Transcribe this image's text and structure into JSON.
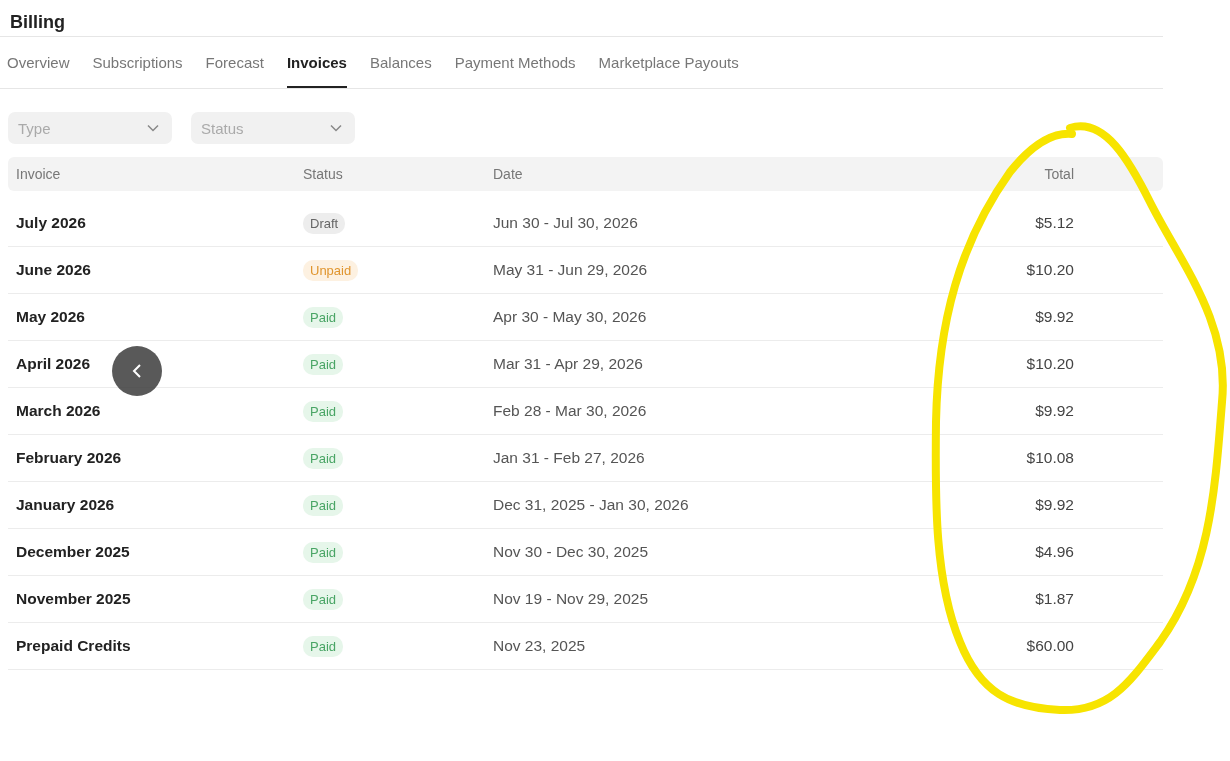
{
  "page_title": "Billing",
  "tabs": [
    {
      "label": "Overview",
      "selected": false
    },
    {
      "label": "Subscriptions",
      "selected": false
    },
    {
      "label": "Forecast",
      "selected": false
    },
    {
      "label": "Invoices",
      "selected": true
    },
    {
      "label": "Balances",
      "selected": false
    },
    {
      "label": "Payment Methods",
      "selected": false
    },
    {
      "label": "Marketplace Payouts",
      "selected": false
    }
  ],
  "filters": [
    {
      "placeholder": "Type"
    },
    {
      "placeholder": "Status"
    }
  ],
  "table": {
    "columns": [
      "Invoice",
      "Status",
      "Date",
      "Total"
    ],
    "rows": [
      {
        "invoice": "July 2026",
        "status": {
          "label": "Draft",
          "kind": "draft"
        },
        "date": "Jun 30 - Jul 30, 2026",
        "total": "$5.12"
      },
      {
        "invoice": "June 2026",
        "status": {
          "label": "Unpaid",
          "kind": "unpaid"
        },
        "date": "May 31 - Jun 29, 2026",
        "total": "$10.20"
      },
      {
        "invoice": "May 2026",
        "status": {
          "label": "Paid",
          "kind": "paid"
        },
        "date": "Apr 30 - May 30, 2026",
        "total": "$9.92"
      },
      {
        "invoice": "April 2026",
        "status": {
          "label": "Paid",
          "kind": "paid"
        },
        "date": "Mar 31 - Apr 29, 2026",
        "total": "$10.20"
      },
      {
        "invoice": "March 2026",
        "status": {
          "label": "Paid",
          "kind": "paid"
        },
        "date": "Feb 28 - Mar 30, 2026",
        "total": "$9.92"
      },
      {
        "invoice": "February 2026",
        "status": {
          "label": "Paid",
          "kind": "paid"
        },
        "date": "Jan 31 - Feb 27, 2026",
        "total": "$10.08"
      },
      {
        "invoice": "January 2026",
        "status": {
          "label": "Paid",
          "kind": "paid"
        },
        "date": "Dec 31, 2025 - Jan 30, 2026",
        "total": "$9.92"
      },
      {
        "invoice": "December 2025",
        "status": {
          "label": "Paid",
          "kind": "paid"
        },
        "date": "Nov 30 - Dec 30, 2025",
        "total": "$4.96"
      },
      {
        "invoice": "November 2025",
        "status": {
          "label": "Paid",
          "kind": "paid"
        },
        "date": "Nov 19 - Nov 29, 2025",
        "total": "$1.87"
      },
      {
        "invoice": "Prepaid Credits",
        "status": {
          "label": "Paid",
          "kind": "paid"
        },
        "date": "Nov 23, 2025",
        "total": "$60.00"
      }
    ]
  }
}
